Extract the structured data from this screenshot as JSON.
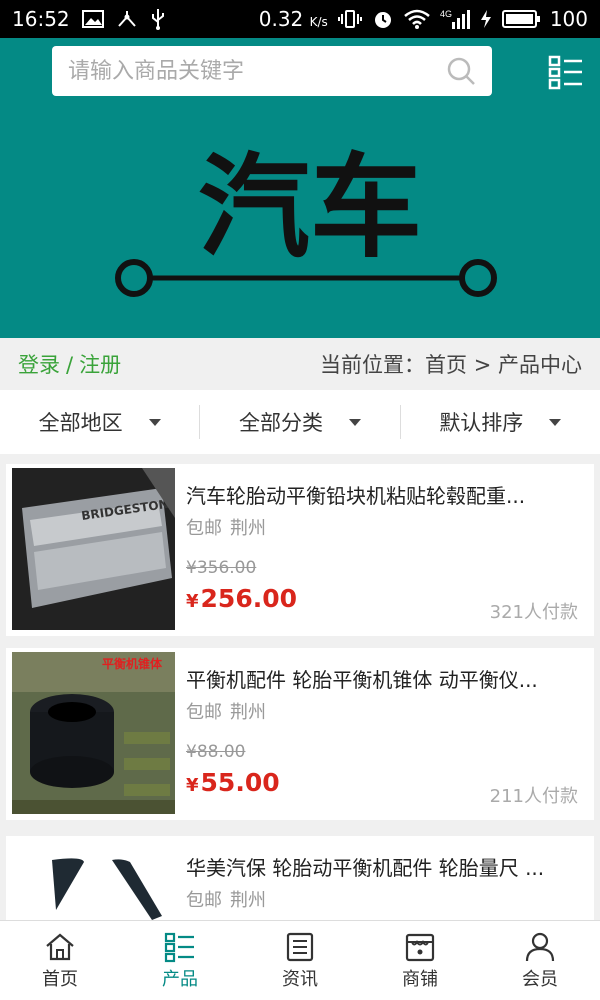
{
  "status_bar": {
    "time": "16:52",
    "speed": "0.32",
    "speed_unit": "K/s",
    "network": "4G",
    "battery": "100"
  },
  "search": {
    "placeholder": "请输入商品关键字"
  },
  "logo_text": "汽车",
  "breadcrumb": {
    "login": "登录",
    "separator": "/",
    "register": "注册",
    "location_label": "当前位置：",
    "home": "首页",
    "arrow": ">",
    "current": "产品中心"
  },
  "filters": [
    {
      "label": "全部地区"
    },
    {
      "label": "全部分类"
    },
    {
      "label": "默认排序"
    }
  ],
  "products": [
    {
      "title": "汽车轮胎动平衡铅块机粘贴轮毂配重...",
      "shipping": "包邮",
      "city": "荆州",
      "old_price": "¥356.00",
      "currency": "¥",
      "price": "256.00",
      "sold": "321人付款",
      "thumb_text": "BRIDGESTONE"
    },
    {
      "title": "平衡机配件 轮胎平衡机锥体 动平衡仪...",
      "shipping": "包邮",
      "city": "荆州",
      "old_price": "¥88.00",
      "currency": "¥",
      "price": "55.00",
      "sold": "211人付款",
      "thumb_text": "平衡机锥体"
    },
    {
      "title": "华美汽保 轮胎动平衡机配件 轮胎量尺 ...",
      "shipping": "包邮",
      "city": "荆州",
      "old_price": "",
      "currency": "",
      "price": "",
      "sold": "",
      "thumb_text": ""
    }
  ],
  "tabs": [
    {
      "label": "首页",
      "icon": "home-icon"
    },
    {
      "label": "产品",
      "icon": "grid-list-icon"
    },
    {
      "label": "资讯",
      "icon": "news-icon"
    },
    {
      "label": "商铺",
      "icon": "shop-icon"
    },
    {
      "label": "会员",
      "icon": "user-icon"
    }
  ],
  "colors": {
    "brand": "#048a85",
    "price": "#d9261c",
    "login": "#3aa33a"
  }
}
